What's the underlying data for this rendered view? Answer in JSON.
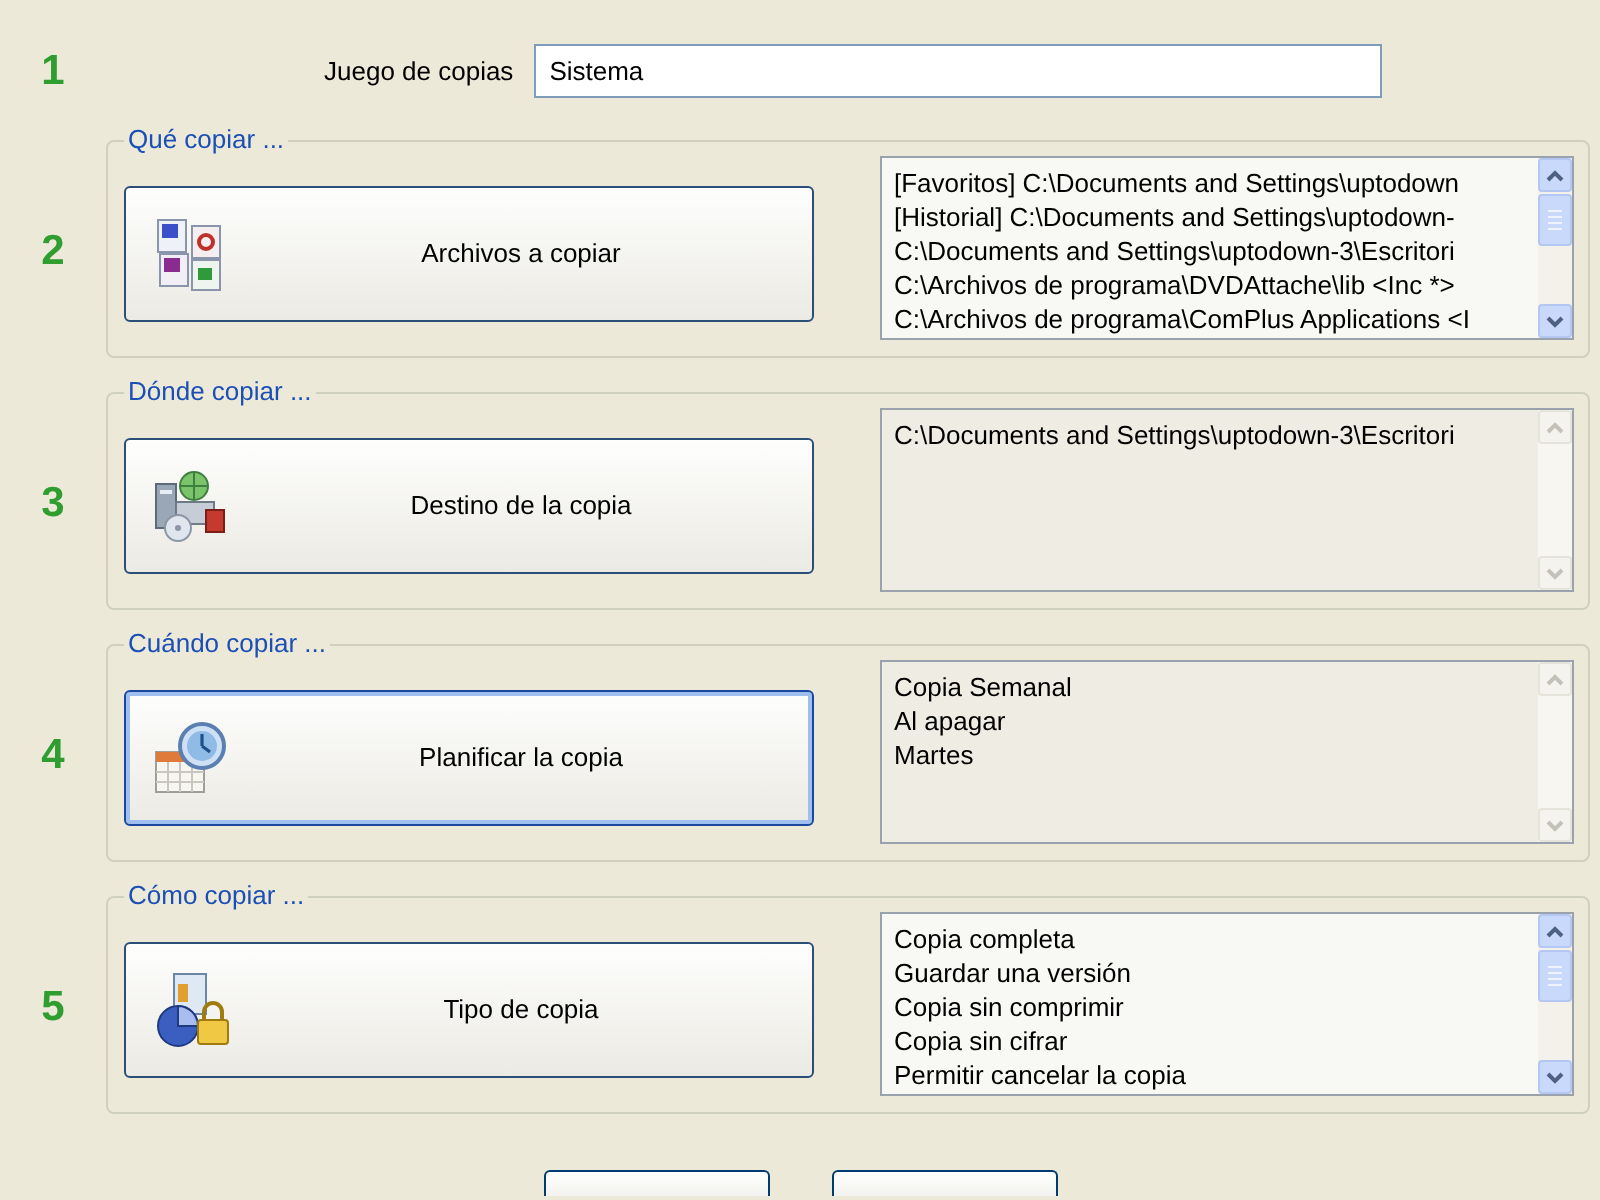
{
  "set_row": {
    "number": "1",
    "label": "Juego de copias",
    "value": "Sistema"
  },
  "sections": [
    {
      "number": "2",
      "title": "Qué copiar ...",
      "button": {
        "label": "Archivos a copiar",
        "focused": false
      },
      "list": {
        "scrollbar_enabled": true,
        "items": [
          "[Favoritos] C:\\Documents and Settings\\uptodown",
          "[Historial] C:\\Documents and Settings\\uptodown-",
          "C:\\Documents and Settings\\uptodown-3\\Escritori",
          "C:\\Archivos de programa\\DVDAttache\\lib <Inc *>",
          "C:\\Archivos de programa\\ComPlus Applications <I"
        ]
      }
    },
    {
      "number": "3",
      "title": "Dónde copiar ...",
      "button": {
        "label": "Destino de la copia",
        "focused": false
      },
      "list": {
        "scrollbar_enabled": false,
        "items": [
          "C:\\Documents and Settings\\uptodown-3\\Escritori"
        ]
      }
    },
    {
      "number": "4",
      "title": "Cuándo copiar ...",
      "button": {
        "label": "Planificar la copia",
        "focused": true
      },
      "list": {
        "scrollbar_enabled": false,
        "items": [
          "Copia Semanal",
          "Al apagar",
          "Martes"
        ]
      }
    },
    {
      "number": "5",
      "title": "Cómo copiar ...",
      "button": {
        "label": "Tipo de copia",
        "focused": false
      },
      "list": {
        "scrollbar_enabled": true,
        "items": [
          "Copia completa",
          "Guardar una versión",
          "Copia sin comprimir",
          "Copia sin cifrar",
          "Permitir cancelar la copia"
        ]
      }
    }
  ]
}
